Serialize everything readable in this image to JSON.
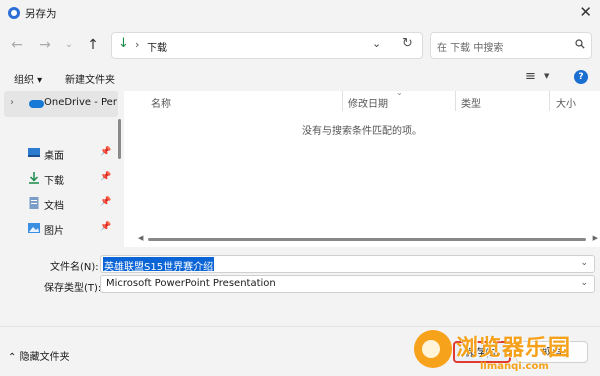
{
  "window": {
    "title": "另存为",
    "close_glyph": "✕"
  },
  "nav": {
    "back_icon": "arrow-left-icon",
    "forward_icon": "arrow-right-icon",
    "recent_icon": "chevron-down-icon",
    "up_icon": "arrow-up-icon",
    "address": {
      "separator": "›",
      "current": "下载"
    },
    "search_placeholder": "在 下载 中搜索"
  },
  "commands": {
    "organize": "组织 ▾",
    "new_folder": "新建文件夹"
  },
  "sidebar": {
    "onedrive": "OneDrive - Per",
    "items": [
      {
        "label": "桌面",
        "icon": "desktop-icon"
      },
      {
        "label": "下载",
        "icon": "download-icon"
      },
      {
        "label": "文档",
        "icon": "document-icon"
      },
      {
        "label": "图片",
        "icon": "pictures-icon"
      }
    ]
  },
  "columns": {
    "name": "名称",
    "modified": "修改日期",
    "type": "类型",
    "size": "大小"
  },
  "empty_message": "没有与搜索条件匹配的项。",
  "form": {
    "filename_label": "文件名(N):",
    "filename_value": "英雄联盟S15世界赛介绍",
    "filetype_label": "保存类型(T):",
    "filetype_value": "Microsoft PowerPoint Presentation"
  },
  "footer": {
    "hide_folders": "隐藏文件夹",
    "save": "保存(S)",
    "cancel": "取消"
  },
  "watermark": {
    "text": "浏览器乐园",
    "url": "llmanqi.com"
  },
  "colors": {
    "accent": "#0a64d6",
    "highlight_border": "#e03b2e",
    "watermark": "#f5a11a"
  }
}
